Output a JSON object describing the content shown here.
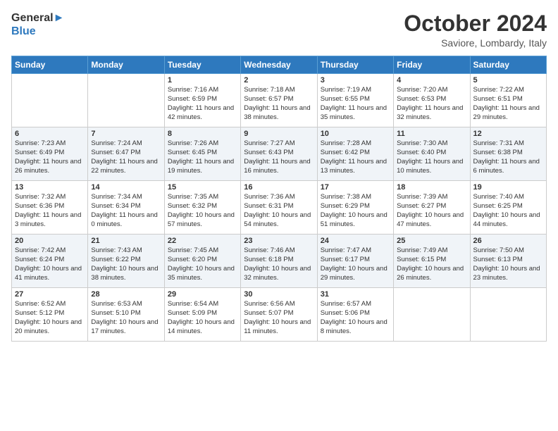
{
  "logo": {
    "line1": "General",
    "line2": "Blue"
  },
  "title": "October 2024",
  "subtitle": "Saviore, Lombardy, Italy",
  "headers": [
    "Sunday",
    "Monday",
    "Tuesday",
    "Wednesday",
    "Thursday",
    "Friday",
    "Saturday"
  ],
  "weeks": [
    [
      {
        "day": "",
        "sunrise": "",
        "sunset": "",
        "daylight": ""
      },
      {
        "day": "",
        "sunrise": "",
        "sunset": "",
        "daylight": ""
      },
      {
        "day": "1",
        "sunrise": "Sunrise: 7:16 AM",
        "sunset": "Sunset: 6:59 PM",
        "daylight": "Daylight: 11 hours and 42 minutes."
      },
      {
        "day": "2",
        "sunrise": "Sunrise: 7:18 AM",
        "sunset": "Sunset: 6:57 PM",
        "daylight": "Daylight: 11 hours and 38 minutes."
      },
      {
        "day": "3",
        "sunrise": "Sunrise: 7:19 AM",
        "sunset": "Sunset: 6:55 PM",
        "daylight": "Daylight: 11 hours and 35 minutes."
      },
      {
        "day": "4",
        "sunrise": "Sunrise: 7:20 AM",
        "sunset": "Sunset: 6:53 PM",
        "daylight": "Daylight: 11 hours and 32 minutes."
      },
      {
        "day": "5",
        "sunrise": "Sunrise: 7:22 AM",
        "sunset": "Sunset: 6:51 PM",
        "daylight": "Daylight: 11 hours and 29 minutes."
      }
    ],
    [
      {
        "day": "6",
        "sunrise": "Sunrise: 7:23 AM",
        "sunset": "Sunset: 6:49 PM",
        "daylight": "Daylight: 11 hours and 26 minutes."
      },
      {
        "day": "7",
        "sunrise": "Sunrise: 7:24 AM",
        "sunset": "Sunset: 6:47 PM",
        "daylight": "Daylight: 11 hours and 22 minutes."
      },
      {
        "day": "8",
        "sunrise": "Sunrise: 7:26 AM",
        "sunset": "Sunset: 6:45 PM",
        "daylight": "Daylight: 11 hours and 19 minutes."
      },
      {
        "day": "9",
        "sunrise": "Sunrise: 7:27 AM",
        "sunset": "Sunset: 6:43 PM",
        "daylight": "Daylight: 11 hours and 16 minutes."
      },
      {
        "day": "10",
        "sunrise": "Sunrise: 7:28 AM",
        "sunset": "Sunset: 6:42 PM",
        "daylight": "Daylight: 11 hours and 13 minutes."
      },
      {
        "day": "11",
        "sunrise": "Sunrise: 7:30 AM",
        "sunset": "Sunset: 6:40 PM",
        "daylight": "Daylight: 11 hours and 10 minutes."
      },
      {
        "day": "12",
        "sunrise": "Sunrise: 7:31 AM",
        "sunset": "Sunset: 6:38 PM",
        "daylight": "Daylight: 11 hours and 6 minutes."
      }
    ],
    [
      {
        "day": "13",
        "sunrise": "Sunrise: 7:32 AM",
        "sunset": "Sunset: 6:36 PM",
        "daylight": "Daylight: 11 hours and 3 minutes."
      },
      {
        "day": "14",
        "sunrise": "Sunrise: 7:34 AM",
        "sunset": "Sunset: 6:34 PM",
        "daylight": "Daylight: 11 hours and 0 minutes."
      },
      {
        "day": "15",
        "sunrise": "Sunrise: 7:35 AM",
        "sunset": "Sunset: 6:32 PM",
        "daylight": "Daylight: 10 hours and 57 minutes."
      },
      {
        "day": "16",
        "sunrise": "Sunrise: 7:36 AM",
        "sunset": "Sunset: 6:31 PM",
        "daylight": "Daylight: 10 hours and 54 minutes."
      },
      {
        "day": "17",
        "sunrise": "Sunrise: 7:38 AM",
        "sunset": "Sunset: 6:29 PM",
        "daylight": "Daylight: 10 hours and 51 minutes."
      },
      {
        "day": "18",
        "sunrise": "Sunrise: 7:39 AM",
        "sunset": "Sunset: 6:27 PM",
        "daylight": "Daylight: 10 hours and 47 minutes."
      },
      {
        "day": "19",
        "sunrise": "Sunrise: 7:40 AM",
        "sunset": "Sunset: 6:25 PM",
        "daylight": "Daylight: 10 hours and 44 minutes."
      }
    ],
    [
      {
        "day": "20",
        "sunrise": "Sunrise: 7:42 AM",
        "sunset": "Sunset: 6:24 PM",
        "daylight": "Daylight: 10 hours and 41 minutes."
      },
      {
        "day": "21",
        "sunrise": "Sunrise: 7:43 AM",
        "sunset": "Sunset: 6:22 PM",
        "daylight": "Daylight: 10 hours and 38 minutes."
      },
      {
        "day": "22",
        "sunrise": "Sunrise: 7:45 AM",
        "sunset": "Sunset: 6:20 PM",
        "daylight": "Daylight: 10 hours and 35 minutes."
      },
      {
        "day": "23",
        "sunrise": "Sunrise: 7:46 AM",
        "sunset": "Sunset: 6:18 PM",
        "daylight": "Daylight: 10 hours and 32 minutes."
      },
      {
        "day": "24",
        "sunrise": "Sunrise: 7:47 AM",
        "sunset": "Sunset: 6:17 PM",
        "daylight": "Daylight: 10 hours and 29 minutes."
      },
      {
        "day": "25",
        "sunrise": "Sunrise: 7:49 AM",
        "sunset": "Sunset: 6:15 PM",
        "daylight": "Daylight: 10 hours and 26 minutes."
      },
      {
        "day": "26",
        "sunrise": "Sunrise: 7:50 AM",
        "sunset": "Sunset: 6:13 PM",
        "daylight": "Daylight: 10 hours and 23 minutes."
      }
    ],
    [
      {
        "day": "27",
        "sunrise": "Sunrise: 6:52 AM",
        "sunset": "Sunset: 5:12 PM",
        "daylight": "Daylight: 10 hours and 20 minutes."
      },
      {
        "day": "28",
        "sunrise": "Sunrise: 6:53 AM",
        "sunset": "Sunset: 5:10 PM",
        "daylight": "Daylight: 10 hours and 17 minutes."
      },
      {
        "day": "29",
        "sunrise": "Sunrise: 6:54 AM",
        "sunset": "Sunset: 5:09 PM",
        "daylight": "Daylight: 10 hours and 14 minutes."
      },
      {
        "day": "30",
        "sunrise": "Sunrise: 6:56 AM",
        "sunset": "Sunset: 5:07 PM",
        "daylight": "Daylight: 10 hours and 11 minutes."
      },
      {
        "day": "31",
        "sunrise": "Sunrise: 6:57 AM",
        "sunset": "Sunset: 5:06 PM",
        "daylight": "Daylight: 10 hours and 8 minutes."
      },
      {
        "day": "",
        "sunrise": "",
        "sunset": "",
        "daylight": ""
      },
      {
        "day": "",
        "sunrise": "",
        "sunset": "",
        "daylight": ""
      }
    ]
  ]
}
